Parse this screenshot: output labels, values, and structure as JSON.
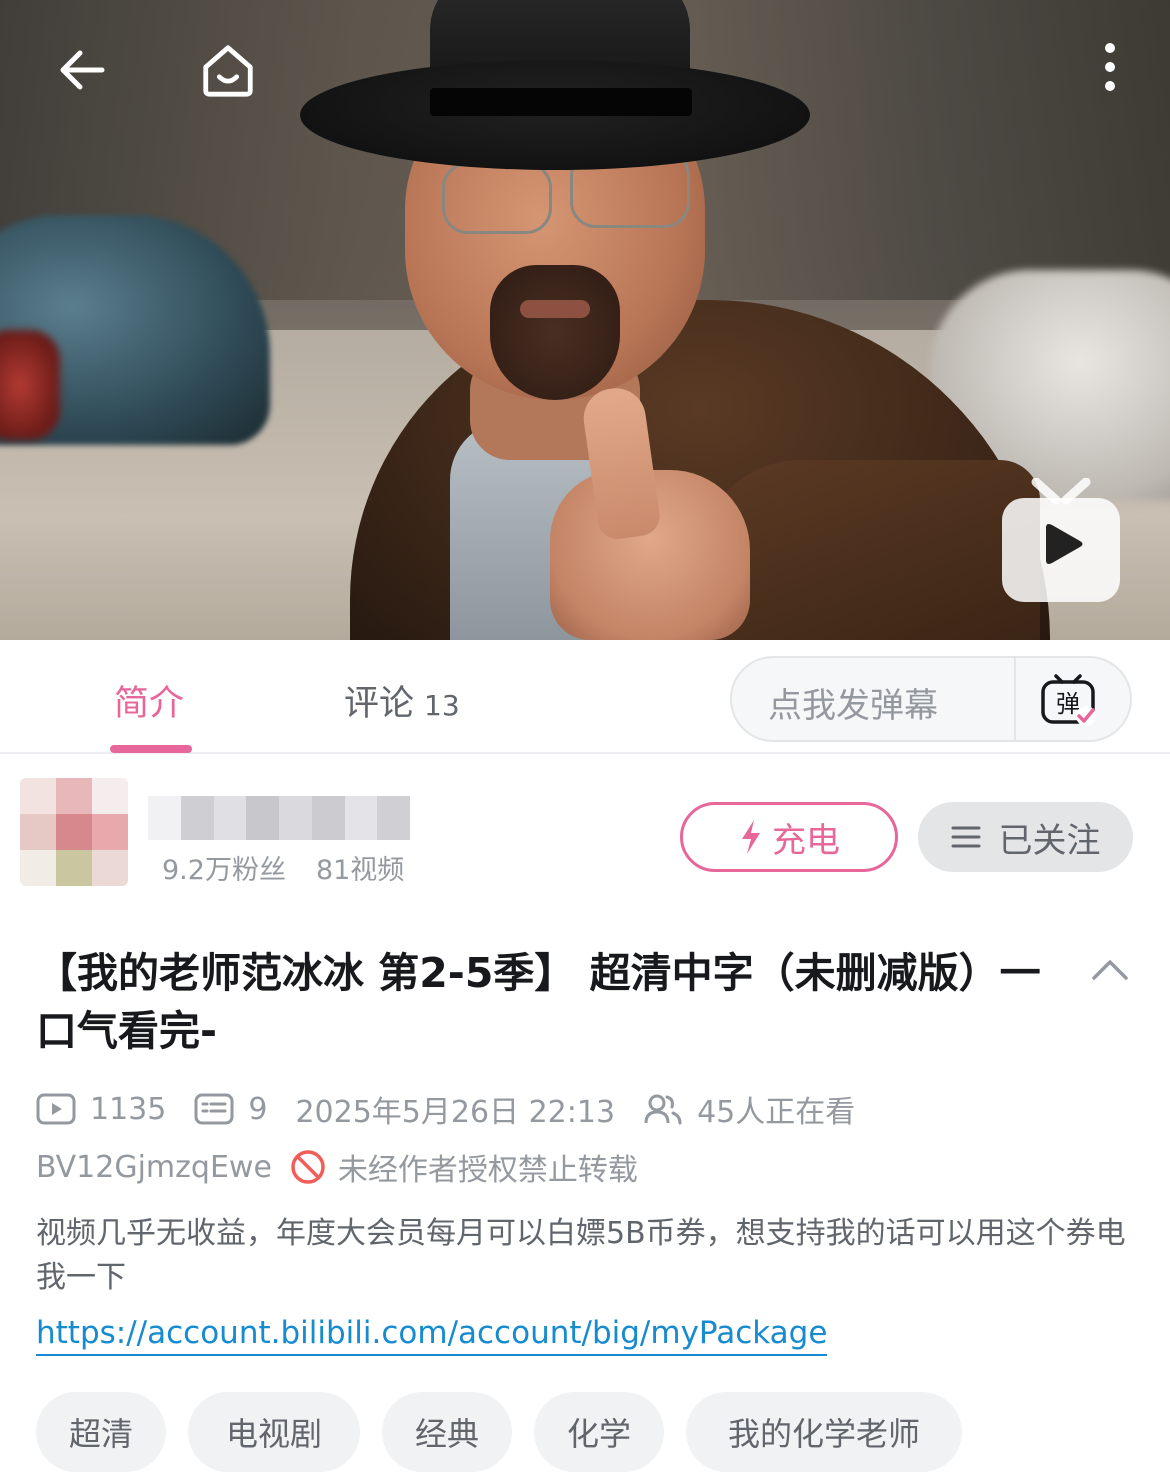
{
  "player": {
    "back_icon": "arrow-left-icon",
    "home_icon": "home-icon",
    "more_icon": "more-vertical-icon",
    "play_icon": "tv-play-icon"
  },
  "tabs": {
    "intro": "简介",
    "comments": "评论",
    "comments_count": "13",
    "active": "intro",
    "accent_color": "#e7679a"
  },
  "danmaku": {
    "placeholder": "点我发弹幕",
    "button_label": "弹"
  },
  "uploader": {
    "fans": "9.2万粉丝",
    "videos": "81视频",
    "charge_label": "充电",
    "follow_label": "已关注"
  },
  "video": {
    "title": "【我的老师范冰冰 第2-5季】 超清中字（未删减版）一口气看完-",
    "views": "1135",
    "danmaku_count": "9",
    "datetime": "2025年5月26日 22:13",
    "watching": "45人正在看",
    "bvid": "BV12GjmzqEwe",
    "copyright": "未经作者授权禁止转载",
    "description": "视频几乎无收益，年度大会员每月可以白嫖5B币券，想支持我的话可以用这个券电我一下",
    "link": "https://account.bilibili.com/account/big/myPackage"
  },
  "tags": [
    "超清",
    "电视剧",
    "经典",
    "化学",
    "我的化学老师"
  ]
}
